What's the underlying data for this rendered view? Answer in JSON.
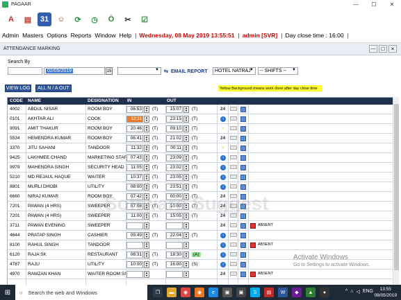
{
  "window": {
    "title": "PAGAAR",
    "min": "—",
    "max": "☐",
    "close": "✕"
  },
  "toolbar": {
    "icons": [
      {
        "name": "app-a-icon",
        "glyph": "A",
        "bg": "#ffffff",
        "fg": "#c0392b"
      },
      {
        "name": "document-icon",
        "glyph": "▤",
        "bg": "#ffffff",
        "fg": "#c0392b"
      },
      {
        "name": "calendar-icon",
        "glyph": "31",
        "bg": "#2f5fb0",
        "fg": "#ffffff"
      },
      {
        "name": "users-icon",
        "glyph": "☺",
        "bg": "#ffffff",
        "fg": "#8a5a2b"
      },
      {
        "name": "refresh-icon",
        "glyph": "⟳",
        "bg": "#ffffff",
        "fg": "#2a8f3a"
      },
      {
        "name": "clock-icon",
        "glyph": "◷",
        "bg": "#ffffff",
        "fg": "#2a8f3a"
      },
      {
        "name": "timer-icon",
        "glyph": "Ö",
        "bg": "#ffffff",
        "fg": "#2a8f3a"
      },
      {
        "name": "tools-icon",
        "glyph": "✂",
        "bg": "#ffffff",
        "fg": "#333333"
      },
      {
        "name": "checklist-icon",
        "glyph": "☑",
        "bg": "#ffffff",
        "fg": "#2a8f3a"
      }
    ]
  },
  "menu": {
    "admin": "Admin",
    "masters": "Masters",
    "options": "Options",
    "reports": "Reports",
    "window": "Window",
    "help": "Help",
    "sep": "|",
    "date": "Wednesday, 08 May 2019 13:55:51",
    "user": "admin [SVR]",
    "close_time": "Day close time : 16:00"
  },
  "form": {
    "title": "ATTENDANCE MARKING",
    "search_label": "Search By",
    "date_value": "02/05/2019",
    "cal": "15",
    "email_report": "EMAIL REPORT",
    "hotel": "HOTEL NATRAJ",
    "shifts": "-- SHIFTS --",
    "view_log": "VIEW LOG",
    "all_na_out": "ALL N / A OUT",
    "legend": "Yellow Background means work done after day close time"
  },
  "grid": {
    "headers": {
      "code": "CODE",
      "name": "NAME",
      "designation": "DESIGNATION",
      "in": "IN",
      "out": "OUT"
    },
    "rows": [
      {
        "code": "4002",
        "name": "ABDUL NISAR",
        "des": "ROOM BOY",
        "in": "06:53",
        "inf": "(T)",
        "out": "15:07",
        "outf": "(T)",
        "mark": "24",
        "absent": ""
      },
      {
        "code": "0101",
        "name": "AKHTAR ALI",
        "des": "COOK",
        "in": "12:11",
        "inf": "(T)",
        "out": "23:15",
        "outf": "(T)",
        "mark": "dot",
        "absent": "",
        "hl": true
      },
      {
        "code": "9091",
        "name": "AMIT THAKUR",
        "des": "ROOM BOY",
        "in": "20:46",
        "inf": "(T)",
        "out": "09:10",
        "outf": "(T)",
        "mark": "bulb",
        "absent": ""
      },
      {
        "code": "5534",
        "name": "HEMENDRA KUMAR",
        "des": "ROOM BOY",
        "in": "06:41",
        "inf": "(T)",
        "out": "21:02",
        "outf": "(T)",
        "mark": "24",
        "absent": ""
      },
      {
        "code": "3370",
        "name": "JITU SAHANI",
        "des": "TANDOOR",
        "in": "11:32",
        "inf": "(T)",
        "out": "00:11",
        "outf": "(T)",
        "mark": "bulb",
        "absent": ""
      },
      {
        "code": "9425",
        "name": "LAKHMEE CHAND",
        "des": "MARKETING STAF",
        "in": "07:43",
        "inf": "(T)",
        "out": "23:09",
        "outf": "(T)",
        "mark": "dot",
        "absent": ""
      },
      {
        "code": "9979",
        "name": "MAHENDRA SINGH",
        "des": "SECURITY HEAD",
        "in": "11:05",
        "inf": "(T)",
        "out": "23:02",
        "outf": "(T)",
        "mark": "dot",
        "absent": ""
      },
      {
        "code": "5210",
        "name": "MD REJAUL HAQUE",
        "des": "WAITER",
        "in": "10:37",
        "inf": "(T)",
        "out": "23:05",
        "outf": "(T)",
        "mark": "dot",
        "absent": ""
      },
      {
        "code": "8801",
        "name": "MURLI DHOBI",
        "des": "UTILITY",
        "in": "08:00",
        "inf": "(T)",
        "out": "23:51",
        "outf": "(T)",
        "mark": "dot",
        "absent": ""
      },
      {
        "code": "6660",
        "name": "NIRAJ KUMAR",
        "des": "ROOM BOY",
        "in": "07:42",
        "inf": "(T)",
        "out": "00:00",
        "outf": "(T)",
        "mark": "24",
        "absent": ""
      },
      {
        "code": "7201",
        "name": "PAWAN (4 HRS)",
        "des": "SWEEPER",
        "in": "07:08",
        "inf": "(T)",
        "out": "10:00",
        "outf": "(T)",
        "mark": "24",
        "absent": ""
      },
      {
        "code": "7201",
        "name": "PAWAN (4 HRS)",
        "des": "SWEEPER",
        "in": "11:00",
        "inf": "(T)",
        "out": "15:05",
        "outf": "(T)",
        "mark": "24",
        "absent": ""
      },
      {
        "code": "3711",
        "name": "PAWAN EVENING",
        "des": "SWEEPER",
        "in": "",
        "inf": "",
        "out": "",
        "outf": "",
        "mark": "24",
        "absent": "ABSENT"
      },
      {
        "code": "4644",
        "name": "PRATAP SINGH",
        "des": "CASHIER",
        "in": "09:49",
        "inf": "(T)",
        "out": "22:04",
        "outf": "(T)",
        "mark": "dot",
        "absent": ""
      },
      {
        "code": "8100",
        "name": "RAHUL SINGH",
        "des": "TANDOOR",
        "in": "",
        "inf": "",
        "out": "",
        "outf": "",
        "mark": "dot",
        "absent": "ABSENT"
      },
      {
        "code": "6120",
        "name": "RAJA SK",
        "des": "RESTAURANT",
        "in": "06:31",
        "inf": "(T)",
        "out": "18:30",
        "outf": "(A)",
        "mark": "dot",
        "absent": "",
        "green": true
      },
      {
        "code": "4787",
        "name": "RAJU",
        "des": "UTILITY",
        "in": "10:00",
        "inf": "(T)",
        "out": "16:00",
        "outf": "(S)",
        "mark": "dot",
        "absent": ""
      },
      {
        "code": "4970",
        "name": "RAMZAN KHAN",
        "des": "WAITER ROOM SI",
        "in": "",
        "inf": "",
        "out": "",
        "outf": "",
        "mark": "24",
        "absent": "ABSENT"
      },
      {
        "code": "",
        "name": "",
        "des": "",
        "in": "",
        "inf": "",
        "out": "",
        "outf": "",
        "mark": "",
        "absent": ""
      }
    ]
  },
  "watermark": "Software Suggest",
  "activate": {
    "line1": "Activate Windows",
    "line2": "Go to Settings to activate Windows."
  },
  "taskbar": {
    "search": "Search the web and Windows",
    "time": "13:55",
    "date": "08/05/2019",
    "lang": "ENG",
    "apps": [
      {
        "name": "task-view-icon",
        "glyph": "❐",
        "bg": "#2b3a4a"
      },
      {
        "name": "folder-icon",
        "glyph": "▬",
        "bg": "#e0a82e"
      },
      {
        "name": "chrome-icon",
        "glyph": "◉",
        "bg": "#d44"
      },
      {
        "name": "firefox-icon",
        "glyph": "◉",
        "bg": "#e87722"
      },
      {
        "name": "ie-icon",
        "glyph": "e",
        "bg": "#1e88e5"
      },
      {
        "name": "store-icon",
        "glyph": "▣",
        "bg": "#555"
      },
      {
        "name": "app-icon",
        "glyph": "▣",
        "bg": "#444"
      },
      {
        "name": "skype-icon",
        "glyph": "S",
        "bg": "#00aff0"
      },
      {
        "name": "pdf-icon",
        "glyph": "▤",
        "bg": "#c62828"
      },
      {
        "name": "word-icon",
        "glyph": "W",
        "bg": "#2b579a"
      },
      {
        "name": "app2-icon",
        "glyph": "◆",
        "bg": "#6a1b9a"
      },
      {
        "name": "app3-icon",
        "glyph": "▲",
        "bg": "#2e7d32"
      },
      {
        "name": "app4-icon",
        "glyph": "●",
        "bg": "#333"
      }
    ]
  }
}
